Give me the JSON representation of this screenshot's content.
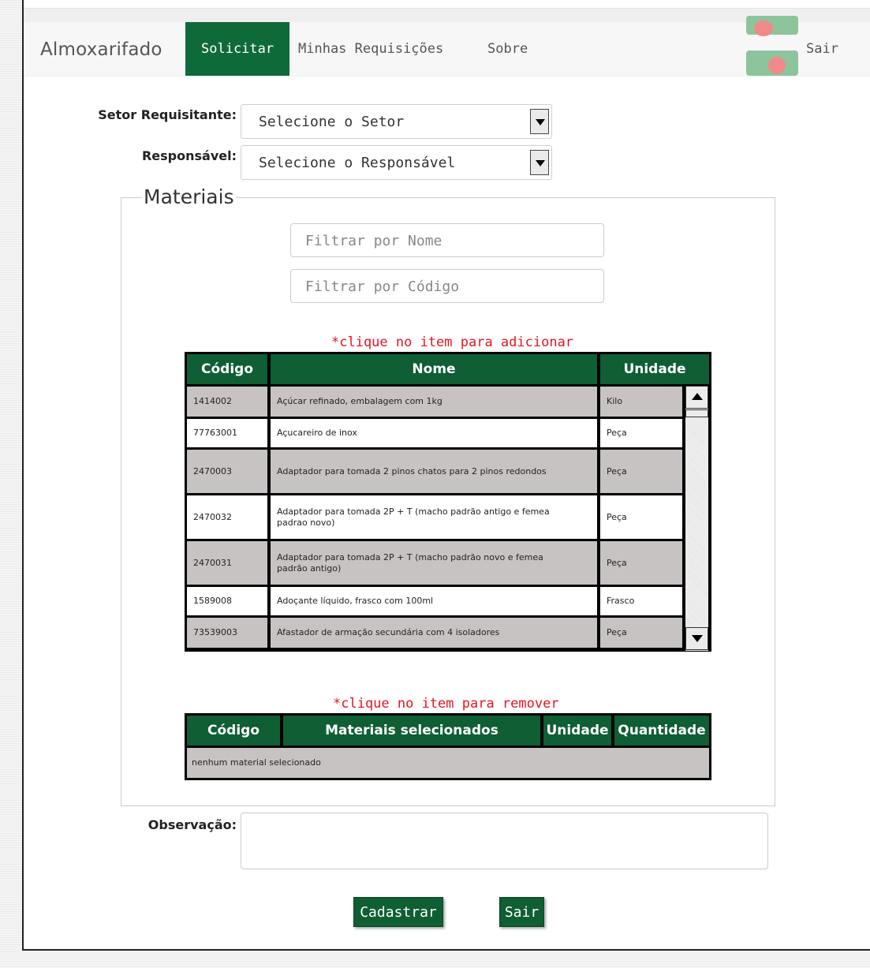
{
  "navbar": {
    "brand": "Almoxarifado",
    "items": [
      {
        "label": "Solicitar",
        "active": true
      },
      {
        "label": "Minhas Requisições"
      },
      {
        "label": "Sobre"
      }
    ],
    "logout": "Sair"
  },
  "form": {
    "setor_label": "Setor Requisitante:",
    "setor_value": "Selecione o Setor",
    "responsavel_label": "Responsável:",
    "responsavel_value": "Selecione o Responsável",
    "observacao_label": "Observação:"
  },
  "materials": {
    "legend": "Materiais",
    "filter_name_placeholder": "Filtrar por Nome",
    "filter_code_placeholder": "Filtrar por Código",
    "add_hint": "*clique no item para adicionar",
    "columns": [
      "Código",
      "Nome",
      "Unidade"
    ],
    "rows": [
      {
        "codigo": "1414002",
        "nome": "Açúcar refinado, embalagem com 1kg",
        "unidade": "Kilo"
      },
      {
        "codigo": "77763001",
        "nome": "Açucareiro de inox",
        "unidade": "Peça"
      },
      {
        "codigo": "2470003",
        "nome": "Adaptador para tomada 2 pinos chatos para 2 pinos redondos",
        "unidade": "Peça"
      },
      {
        "codigo": "2470032",
        "nome": "Adaptador para tomada 2P + T (macho padrão antigo e femea padrao novo)",
        "unidade": "Peça"
      },
      {
        "codigo": "2470031",
        "nome": "Adaptador para tomada 2P + T (macho padrão novo e femea padrão antigo)",
        "unidade": "Peça"
      },
      {
        "codigo": "1589008",
        "nome": "Adoçante líquido, frasco com 100ml",
        "unidade": "Frasco"
      },
      {
        "codigo": "73539003",
        "nome": "Afastador de armação secundária com 4 isoladores",
        "unidade": "Peça"
      }
    ],
    "remove_hint": "*clique no item para remover",
    "selected_columns": [
      "Código",
      "Materiais selecionados",
      "Unidade",
      "Quantidade"
    ],
    "selected_empty": "nenhum material selecionado"
  },
  "buttons": {
    "submit": "Cadastrar",
    "exit": "Sair"
  },
  "colors": {
    "primary_green": "#0f5e34",
    "hint_red": "#e8141e"
  }
}
